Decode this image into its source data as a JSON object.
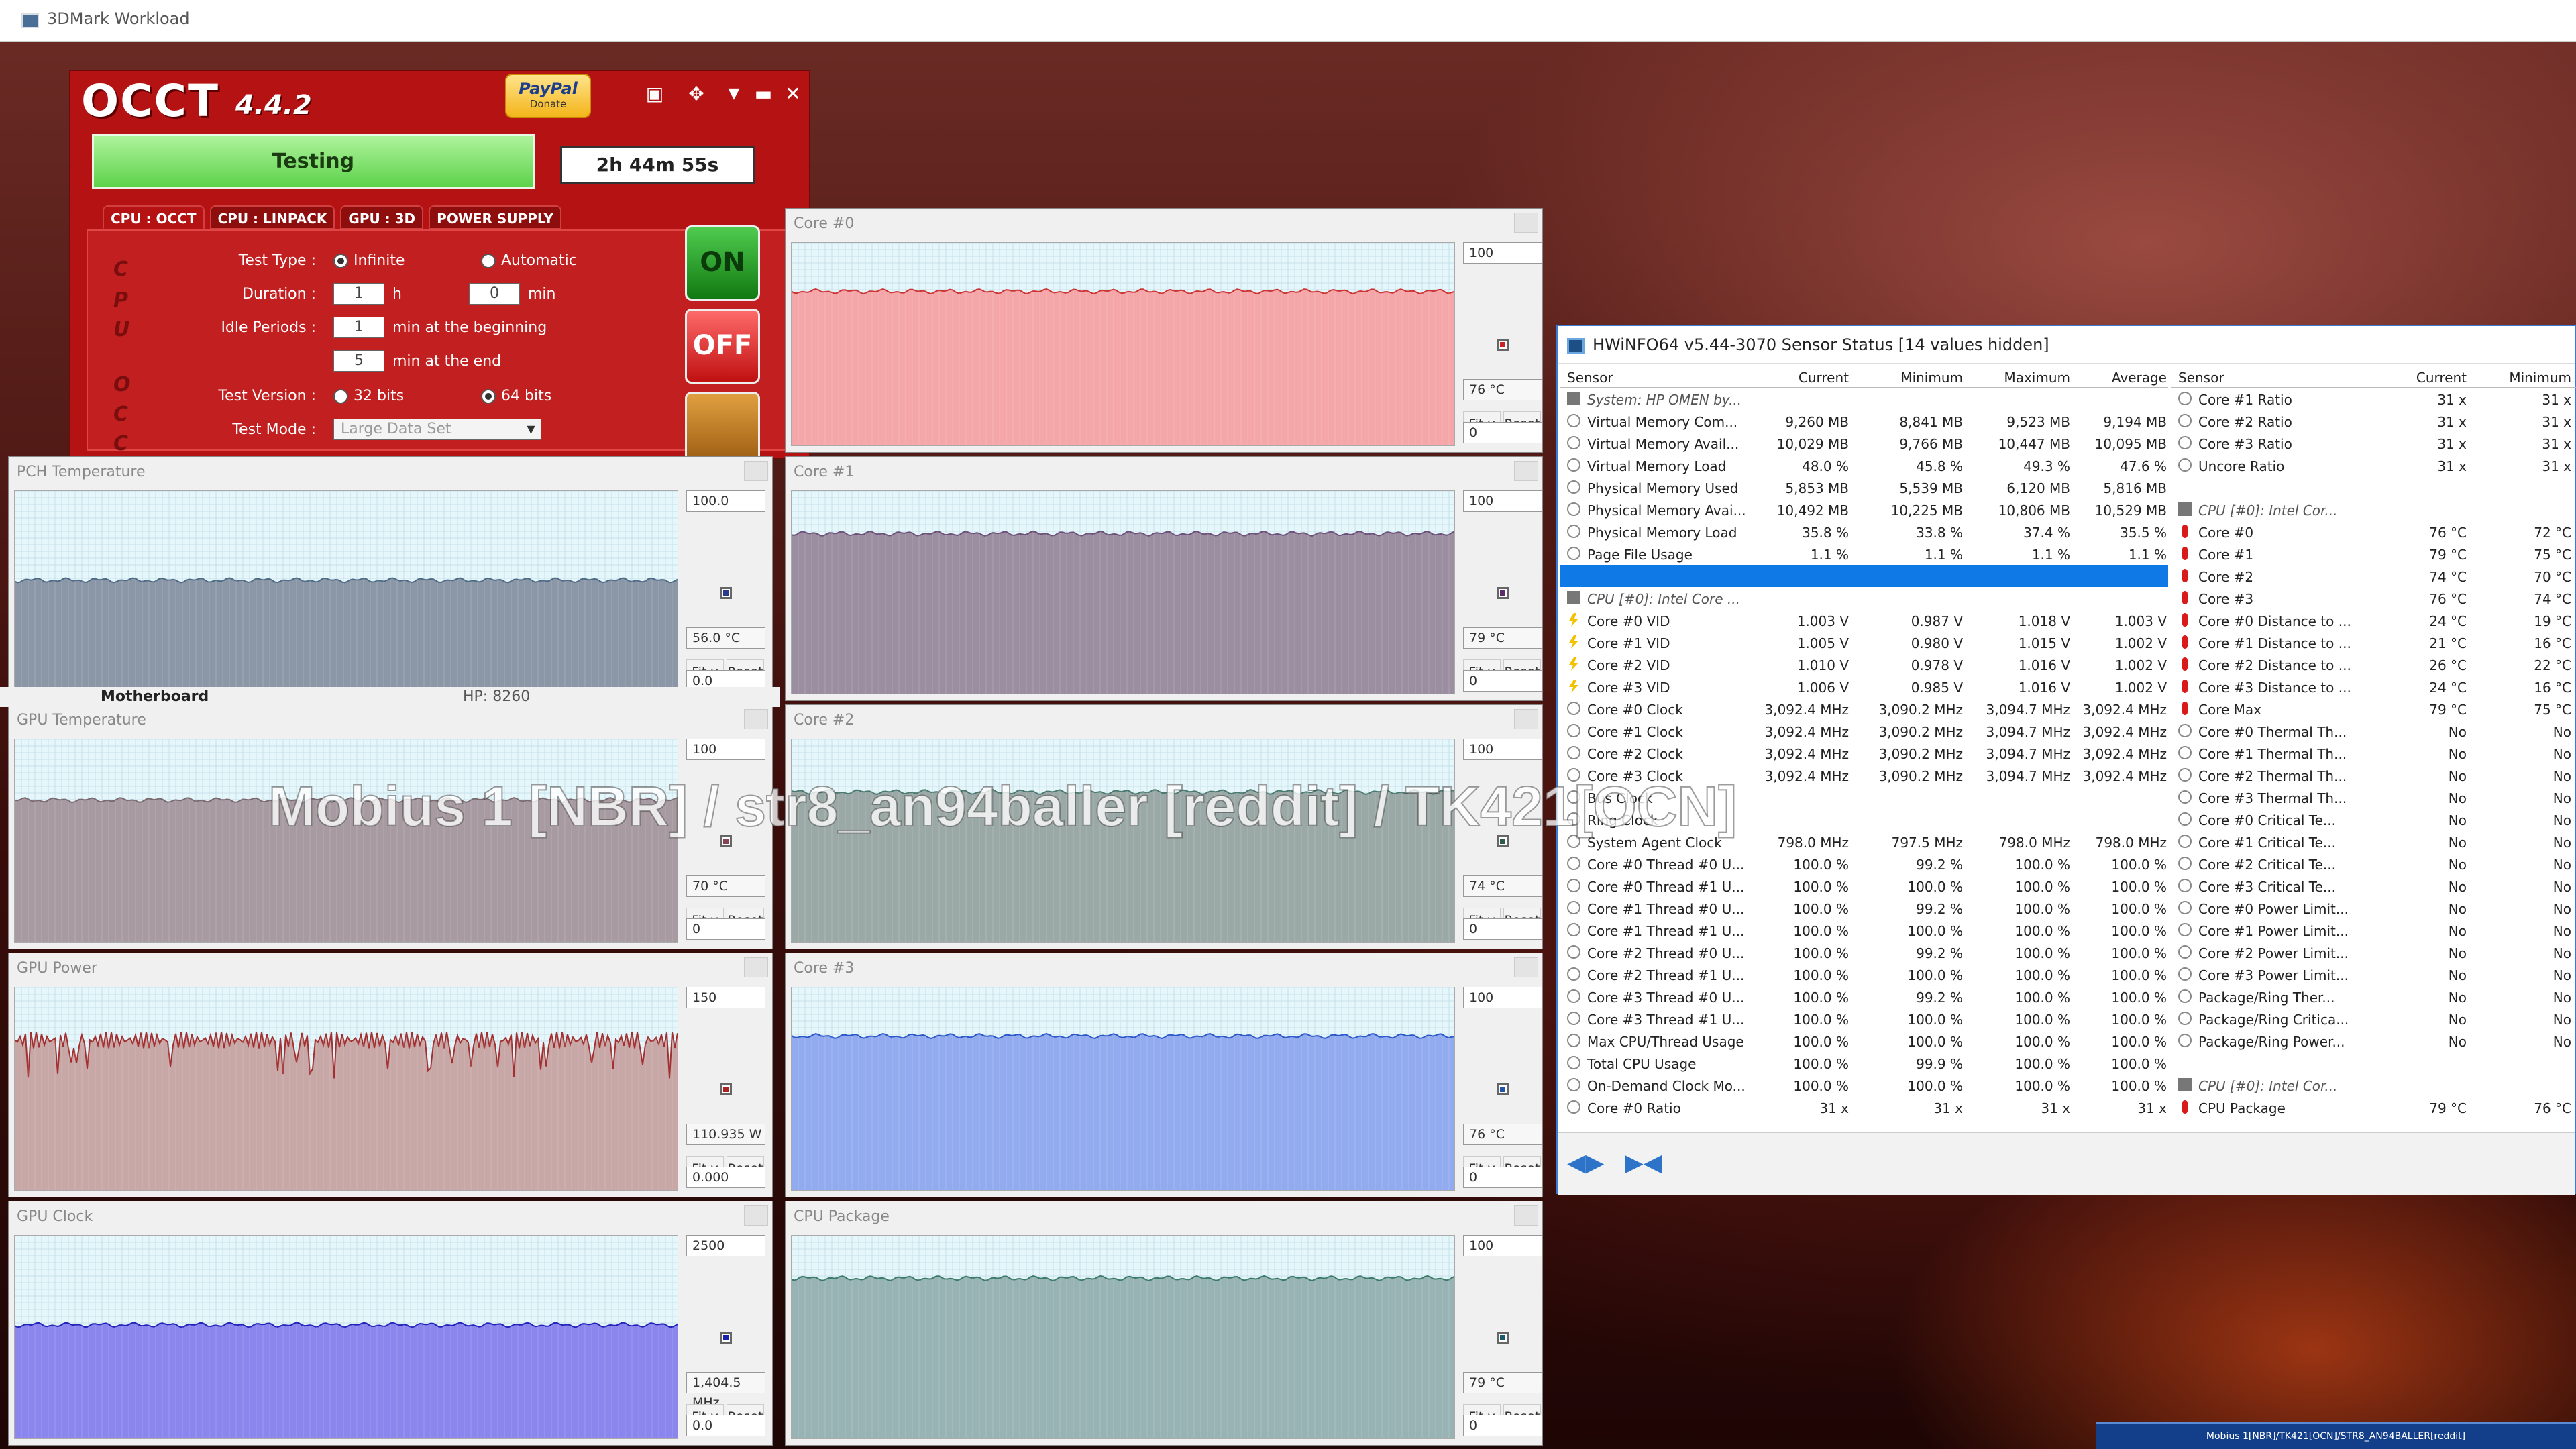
{
  "window": {
    "title": "3DMark Workload"
  },
  "occt": {
    "logo": "OCCT",
    "version": "4.4.2",
    "paypal": {
      "label": "PayPal",
      "sub": "Donate"
    },
    "status_label": "Testing",
    "timer": "2h 44m 55s",
    "tabs": [
      "CPU : OCCT",
      "CPU : LINPACK",
      "GPU : 3D",
      "POWER SUPPLY"
    ],
    "side_letters": [
      "C",
      "P",
      "U",
      "O",
      "C",
      "C"
    ],
    "form": {
      "test_type_label": "Test Type :",
      "test_type_opt1": "Infinite",
      "test_type_opt2": "Automatic",
      "duration_label": "Duration :",
      "duration_h": "1",
      "h": "h",
      "duration_min": "0",
      "min": "min",
      "idle_label": "Idle Periods :",
      "idle_begin": "1",
      "idle_begin_text": "min at the beginning",
      "idle_end": "5",
      "idle_end_text": "min at the end",
      "version_label": "Test Version :",
      "v32": "32 bits",
      "v64": "64 bits",
      "mode_label": "Test Mode :",
      "mode_value": "Large Data Set"
    },
    "on_label": "ON",
    "off_label": "OFF"
  },
  "motherboard": {
    "label": "Motherboard",
    "value": "HP: 8260"
  },
  "graphs": [
    {
      "title": "Core #0",
      "max": "100",
      "current": "76 °C",
      "min": "0",
      "color": "#f4a6a8",
      "line": "#cc3333",
      "level": 0.76,
      "dot": "#cc2222"
    },
    {
      "title": "PCH Temperature",
      "max": "100.0",
      "current": "56.0 °C",
      "min": "0.0",
      "color": "#8b97a6",
      "line": "#4d6a85",
      "level": 0.56,
      "dot": "#2a3a8a"
    },
    {
      "title": "Core #1",
      "max": "100",
      "current": "79 °C",
      "min": "0",
      "color": "#9b8ea0",
      "line": "#6b4f7a",
      "level": 0.79,
      "dot": "#5a2a6a"
    },
    {
      "title": "GPU Temperature",
      "max": "100",
      "current": "70 °C",
      "min": "0",
      "color": "#a79aa0",
      "line": "#7a6a70",
      "level": 0.7,
      "dot": "#884455"
    },
    {
      "title": "Core #2",
      "max": "100",
      "current": "74 °C",
      "min": "0",
      "color": "#9aa8a6",
      "line": "#4a7a6f",
      "level": 0.74,
      "dot": "#2a5a4a"
    },
    {
      "title": "GPU Power",
      "max": "150",
      "current": "110.935 W",
      "min": "0.000",
      "color": "#c8a7a7",
      "line": "#a33030",
      "level": 0.74,
      "dot": "#aa2222"
    },
    {
      "title": "Core #3",
      "max": "100",
      "current": "76 °C",
      "min": "0",
      "color": "#92aaee",
      "line": "#2a56c8",
      "level": 0.76,
      "dot": "#2255aa"
    },
    {
      "title": "GPU Clock",
      "max": "2500",
      "current": "1,404.5 MHz",
      "min": "0.0",
      "color": "#8a86ee",
      "line": "#2222bb",
      "level": 0.56,
      "dot": "#1a22aa"
    },
    {
      "title": "CPU Package",
      "max": "100",
      "current": "79 °C",
      "min": "0",
      "color": "#97b3b3",
      "line": "#3a7a6a",
      "level": 0.79,
      "dot": "#1a5a6a"
    }
  ],
  "graph_buttons": {
    "fit": "Fit y",
    "reset": "Reset"
  },
  "overlay_text": "Mobius 1 [NBR] / str8_an94baller [reddit] / TK421[OCN]",
  "hwinfo": {
    "title": "HWiNFO64 v5.44-3070 Sensor Status [14 values hidden]",
    "headers": [
      "Sensor",
      "Current",
      "Minimum",
      "Maximum",
      "Average"
    ],
    "rows": [
      {
        "icon": "chip",
        "group": true,
        "name": "System: HP OMEN by...",
        "v": [
          "",
          "",
          "",
          ""
        ]
      },
      {
        "icon": "circ",
        "name": "Virtual Memory Com...",
        "v": [
          "9,260 MB",
          "8,841 MB",
          "9,523 MB",
          "9,194 MB"
        ]
      },
      {
        "icon": "circ",
        "name": "Virtual Memory Avail...",
        "v": [
          "10,029 MB",
          "9,766 MB",
          "10,447 MB",
          "10,095 MB"
        ]
      },
      {
        "icon": "circ",
        "name": "Virtual Memory Load",
        "v": [
          "48.0 %",
          "45.8 %",
          "49.3 %",
          "47.6 %"
        ]
      },
      {
        "icon": "circ",
        "name": "Physical Memory Used",
        "v": [
          "5,853 MB",
          "5,539 MB",
          "6,120 MB",
          "5,816 MB"
        ]
      },
      {
        "icon": "circ",
        "name": "Physical Memory Avai...",
        "v": [
          "10,492 MB",
          "10,225 MB",
          "10,806 MB",
          "10,529 MB"
        ]
      },
      {
        "icon": "circ",
        "name": "Physical Memory Load",
        "v": [
          "35.8 %",
          "33.8 %",
          "37.4 %",
          "35.5 %"
        ]
      },
      {
        "icon": "circ",
        "name": "Page File Usage",
        "v": [
          "1.1 %",
          "1.1 %",
          "1.1 %",
          "1.1 %"
        ]
      },
      {
        "icon": "",
        "sel": true,
        "name": "",
        "v": [
          "",
          "",
          "",
          ""
        ]
      },
      {
        "icon": "chip",
        "group": true,
        "name": "CPU [#0]: Intel Core ...",
        "v": [
          "",
          "",
          "",
          ""
        ]
      },
      {
        "icon": "bolt",
        "name": "Core #0 VID",
        "v": [
          "1.003 V",
          "0.987 V",
          "1.018 V",
          "1.003 V"
        ]
      },
      {
        "icon": "bolt",
        "name": "Core #1 VID",
        "v": [
          "1.005 V",
          "0.980 V",
          "1.015 V",
          "1.002 V"
        ]
      },
      {
        "icon": "bolt",
        "name": "Core #2 VID",
        "v": [
          "1.010 V",
          "0.978 V",
          "1.016 V",
          "1.002 V"
        ]
      },
      {
        "icon": "bolt",
        "name": "Core #3 VID",
        "v": [
          "1.006 V",
          "0.985 V",
          "1.016 V",
          "1.002 V"
        ]
      },
      {
        "icon": "circ",
        "name": "Core #0 Clock",
        "v": [
          "3,092.4 MHz",
          "3,090.2 MHz",
          "3,094.7 MHz",
          "3,092.4 MHz"
        ]
      },
      {
        "icon": "circ",
        "name": "Core #1 Clock",
        "v": [
          "3,092.4 MHz",
          "3,090.2 MHz",
          "3,094.7 MHz",
          "3,092.4 MHz"
        ]
      },
      {
        "icon": "circ",
        "name": "Core #2 Clock",
        "v": [
          "3,092.4 MHz",
          "3,090.2 MHz",
          "3,094.7 MHz",
          "3,092.4 MHz"
        ]
      },
      {
        "icon": "circ",
        "name": "Core #3 Clock",
        "v": [
          "3,092.4 MHz",
          "3,090.2 MHz",
          "3,094.7 MHz",
          "3,092.4 MHz"
        ]
      },
      {
        "icon": "circ",
        "name": "Bus Clock",
        "v": [
          "",
          "",
          "",
          ""
        ]
      },
      {
        "icon": "circ",
        "name": "Ring Clock",
        "v": [
          "",
          "",
          "",
          ""
        ]
      },
      {
        "icon": "circ",
        "name": "System Agent Clock",
        "v": [
          "798.0 MHz",
          "797.5 MHz",
          "798.0 MHz",
          "798.0 MHz"
        ]
      },
      {
        "icon": "circ",
        "name": "Core #0 Thread #0 U...",
        "v": [
          "100.0 %",
          "99.2 %",
          "100.0 %",
          "100.0 %"
        ]
      },
      {
        "icon": "circ",
        "name": "Core #0 Thread #1 U...",
        "v": [
          "100.0 %",
          "100.0 %",
          "100.0 %",
          "100.0 %"
        ]
      },
      {
        "icon": "circ",
        "name": "Core #1 Thread #0 U...",
        "v": [
          "100.0 %",
          "99.2 %",
          "100.0 %",
          "100.0 %"
        ]
      },
      {
        "icon": "circ",
        "name": "Core #1 Thread #1 U...",
        "v": [
          "100.0 %",
          "100.0 %",
          "100.0 %",
          "100.0 %"
        ]
      },
      {
        "icon": "circ",
        "name": "Core #2 Thread #0 U...",
        "v": [
          "100.0 %",
          "99.2 %",
          "100.0 %",
          "100.0 %"
        ]
      },
      {
        "icon": "circ",
        "name": "Core #2 Thread #1 U...",
        "v": [
          "100.0 %",
          "100.0 %",
          "100.0 %",
          "100.0 %"
        ]
      },
      {
        "icon": "circ",
        "name": "Core #3 Thread #0 U...",
        "v": [
          "100.0 %",
          "99.2 %",
          "100.0 %",
          "100.0 %"
        ]
      },
      {
        "icon": "circ",
        "name": "Core #3 Thread #1 U...",
        "v": [
          "100.0 %",
          "100.0 %",
          "100.0 %",
          "100.0 %"
        ]
      },
      {
        "icon": "circ",
        "name": "Max CPU/Thread Usage",
        "v": [
          "100.0 %",
          "100.0 %",
          "100.0 %",
          "100.0 %"
        ]
      },
      {
        "icon": "circ",
        "name": "Total CPU Usage",
        "v": [
          "100.0 %",
          "99.9 %",
          "100.0 %",
          "100.0 %"
        ]
      },
      {
        "icon": "circ",
        "name": "On-Demand Clock Mo...",
        "v": [
          "100.0 %",
          "100.0 %",
          "100.0 %",
          "100.0 %"
        ]
      },
      {
        "icon": "circ",
        "name": "Core #0 Ratio",
        "v": [
          "31 x",
          "31 x",
          "31 x",
          "31 x"
        ]
      }
    ],
    "headers2": [
      "Sensor",
      "Current",
      "Minimum"
    ],
    "rows2": [
      {
        "icon": "circ",
        "name": "Core #1 Ratio",
        "v": [
          "31 x",
          "31 x"
        ]
      },
      {
        "icon": "circ",
        "name": "Core #2 Ratio",
        "v": [
          "31 x",
          "31 x"
        ]
      },
      {
        "icon": "circ",
        "name": "Core #3 Ratio",
        "v": [
          "31 x",
          "31 x"
        ]
      },
      {
        "icon": "circ",
        "name": "Uncore Ratio",
        "v": [
          "31 x",
          "31 x"
        ]
      },
      {
        "icon": "",
        "name": "",
        "v": [
          "",
          ""
        ]
      },
      {
        "icon": "chip",
        "group": true,
        "name": "CPU [#0]: Intel Cor...",
        "v": [
          "",
          ""
        ]
      },
      {
        "icon": "therm",
        "name": "Core #0",
        "v": [
          "76 °C",
          "72 °C"
        ]
      },
      {
        "icon": "therm",
        "name": "Core #1",
        "v": [
          "79 °C",
          "75 °C"
        ]
      },
      {
        "icon": "therm",
        "name": "Core #2",
        "v": [
          "74 °C",
          "70 °C"
        ]
      },
      {
        "icon": "therm",
        "name": "Core #3",
        "v": [
          "76 °C",
          "74 °C"
        ]
      },
      {
        "icon": "therm",
        "name": "Core #0 Distance to ...",
        "v": [
          "24 °C",
          "19 °C"
        ]
      },
      {
        "icon": "therm",
        "name": "Core #1 Distance to ...",
        "v": [
          "21 °C",
          "16 °C"
        ]
      },
      {
        "icon": "therm",
        "name": "Core #2 Distance to ...",
        "v": [
          "26 °C",
          "22 °C"
        ]
      },
      {
        "icon": "therm",
        "name": "Core #3 Distance to ...",
        "v": [
          "24 °C",
          "16 °C"
        ]
      },
      {
        "icon": "therm",
        "name": "Core Max",
        "v": [
          "79 °C",
          "75 °C"
        ]
      },
      {
        "icon": "circ",
        "name": "Core #0 Thermal Th...",
        "v": [
          "No",
          "No"
        ]
      },
      {
        "icon": "circ",
        "name": "Core #1 Thermal Th...",
        "v": [
          "No",
          "No"
        ]
      },
      {
        "icon": "circ",
        "name": "Core #2 Thermal Th...",
        "v": [
          "No",
          "No"
        ]
      },
      {
        "icon": "circ",
        "name": "Core #3 Thermal Th...",
        "v": [
          "No",
          "No"
        ]
      },
      {
        "icon": "circ",
        "name": "Core #0 Critical Te...",
        "v": [
          "No",
          "No"
        ]
      },
      {
        "icon": "circ",
        "name": "Core #1 Critical Te...",
        "v": [
          "No",
          "No"
        ]
      },
      {
        "icon": "circ",
        "name": "Core #2 Critical Te...",
        "v": [
          "No",
          "No"
        ]
      },
      {
        "icon": "circ",
        "name": "Core #3 Critical Te...",
        "v": [
          "No",
          "No"
        ]
      },
      {
        "icon": "circ",
        "name": "Core #0 Power Limit...",
        "v": [
          "No",
          "No"
        ]
      },
      {
        "icon": "circ",
        "name": "Core #1 Power Limit...",
        "v": [
          "No",
          "No"
        ]
      },
      {
        "icon": "circ",
        "name": "Core #2 Power Limit...",
        "v": [
          "No",
          "No"
        ]
      },
      {
        "icon": "circ",
        "name": "Core #3 Power Limit...",
        "v": [
          "No",
          "No"
        ]
      },
      {
        "icon": "circ",
        "name": "Package/Ring Ther...",
        "v": [
          "No",
          "No"
        ]
      },
      {
        "icon": "circ",
        "name": "Package/Ring Critica...",
        "v": [
          "No",
          "No"
        ]
      },
      {
        "icon": "circ",
        "name": "Package/Ring Power...",
        "v": [
          "No",
          "No"
        ]
      },
      {
        "icon": "",
        "name": "",
        "v": [
          "",
          ""
        ]
      },
      {
        "icon": "chip",
        "group": true,
        "name": "CPU [#0]: Intel Cor...",
        "v": [
          "",
          ""
        ]
      },
      {
        "icon": "therm",
        "name": "CPU Package",
        "v": [
          "79 °C",
          "76 °C"
        ]
      }
    ]
  },
  "taskbar": {
    "item": "Mobius 1[NBR]/TK421[OCN]/STR8_AN94BALLER[reddit]"
  }
}
